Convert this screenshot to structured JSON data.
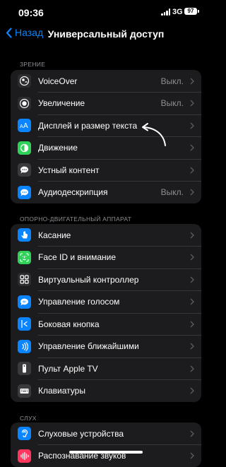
{
  "status": {
    "time": "09:36",
    "network": "3G",
    "battery": "97"
  },
  "nav": {
    "back_label": "Назад",
    "title": "Универсальный доступ"
  },
  "sections": [
    {
      "header": "ЗРЕНИЕ",
      "items": [
        {
          "label": "VoiceOver",
          "value": "Выкл.",
          "icon": "voiceover-icon",
          "color": "#2c2c2e"
        },
        {
          "label": "Увеличение",
          "value": "Выкл.",
          "icon": "zoom-icon",
          "color": "#2c2c2e"
        },
        {
          "label": "Дисплей и размер текста",
          "value": "",
          "icon": "text-size-icon",
          "color": "#0a84ff"
        },
        {
          "label": "Движение",
          "value": "",
          "icon": "motion-icon",
          "color": "#30d158"
        },
        {
          "label": "Устный контент",
          "value": "",
          "icon": "speech-icon",
          "color": "#3a3a3c"
        },
        {
          "label": "Аудиодескрипция",
          "value": "Выкл.",
          "icon": "audio-description-icon",
          "color": "#0a84ff"
        }
      ]
    },
    {
      "header": "ОПОРНО-ДВИГАТЕЛЬНЫЙ АППАРАТ",
      "items": [
        {
          "label": "Касание",
          "value": "",
          "icon": "touch-icon",
          "color": "#0a84ff"
        },
        {
          "label": "Face ID и внимание",
          "value": "",
          "icon": "face-id-icon",
          "color": "#30d158"
        },
        {
          "label": "Виртуальный контроллер",
          "value": "",
          "icon": "switch-control-icon",
          "color": "#2c2c2e"
        },
        {
          "label": "Управление голосом",
          "value": "",
          "icon": "voice-control-icon",
          "color": "#0a84ff"
        },
        {
          "label": "Боковая кнопка",
          "value": "",
          "icon": "side-button-icon",
          "color": "#0a84ff"
        },
        {
          "label": "Управление ближайшими",
          "value": "",
          "icon": "nearby-devices-icon",
          "color": "#0a84ff"
        },
        {
          "label": "Пульт Apple TV",
          "value": "",
          "icon": "tv-remote-icon",
          "color": "#3a3a3c"
        },
        {
          "label": "Клавиатуры",
          "value": "",
          "icon": "keyboard-icon",
          "color": "#3a3a3c"
        }
      ]
    },
    {
      "header": "СЛУХ",
      "items": [
        {
          "label": "Слуховые устройства",
          "value": "",
          "icon": "hearing-icon",
          "color": "#0a84ff"
        },
        {
          "label": "Распознавание звуков",
          "value": "",
          "icon": "sound-recognition-icon",
          "color": "#ff375f"
        }
      ]
    }
  ]
}
